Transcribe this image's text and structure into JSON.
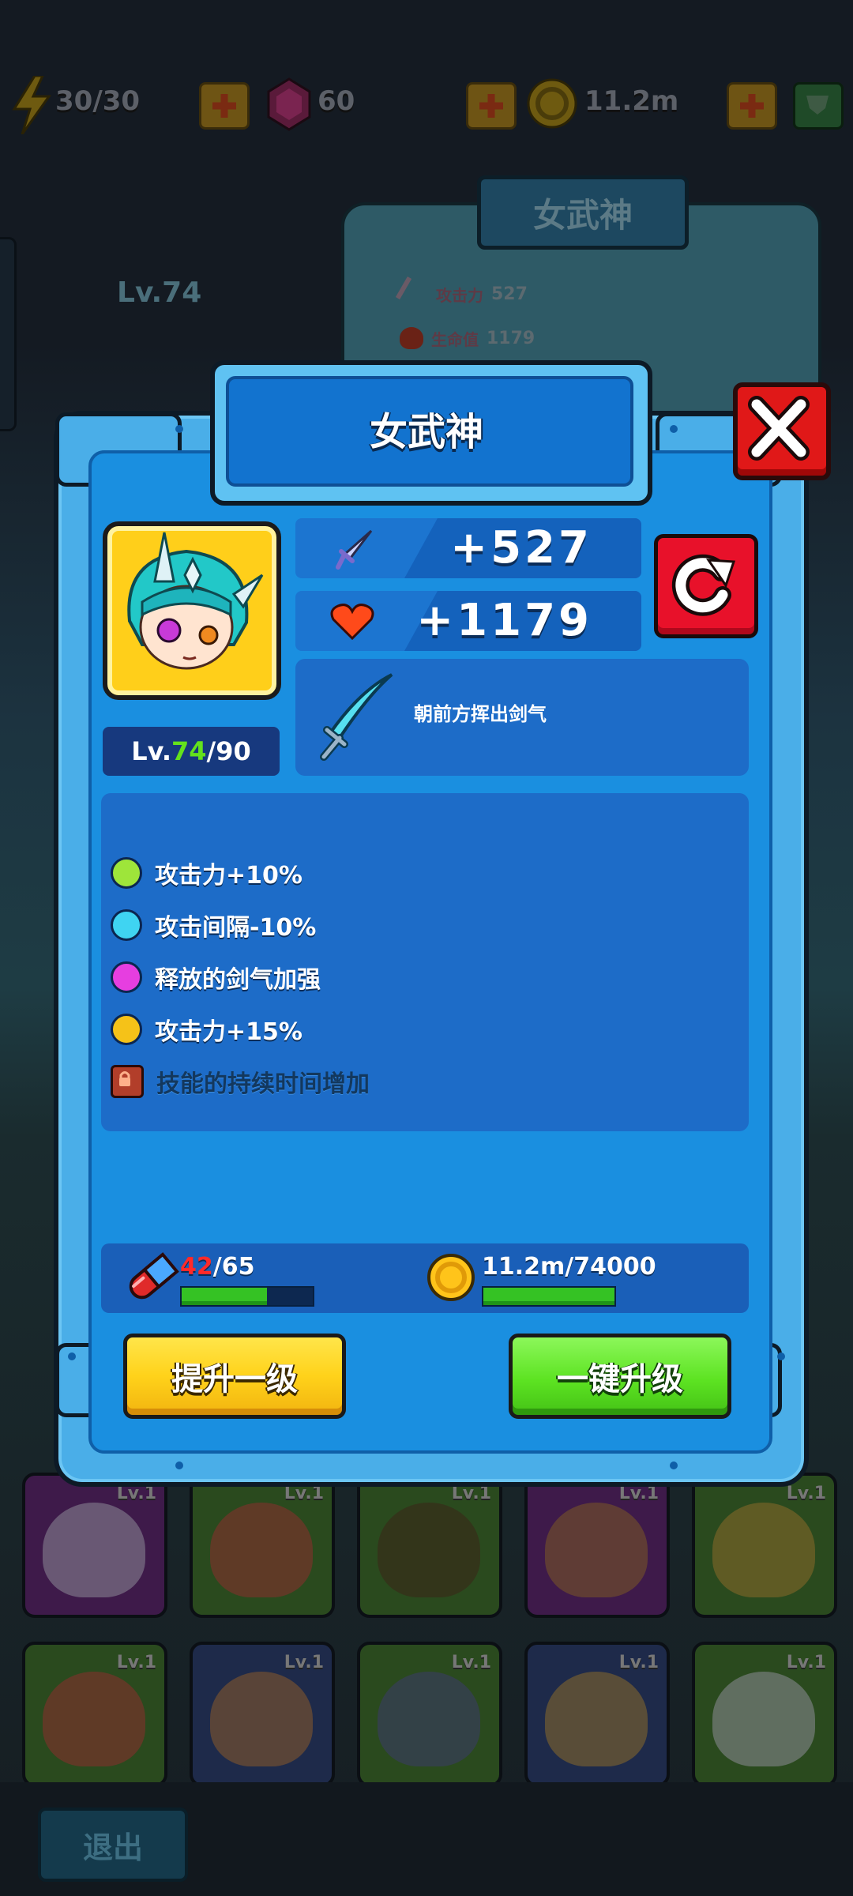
{
  "top_bar": {
    "energy": "30/30",
    "gems": "60",
    "gold": "11.2m"
  },
  "background": {
    "hero_name": "女武神",
    "hero_level": "Lv.74",
    "attack_label": "攻击力",
    "attack_value": "527",
    "hp_label": "生命值",
    "hp_value": "1179",
    "card_level": "Lv.1",
    "exit_label": "退出"
  },
  "dialog": {
    "title": "女武神",
    "level_current": "74",
    "level_prefix": "Lv.",
    "level_max": "/90",
    "attack_bonus": "+527",
    "hp_bonus": "+1179",
    "skill_description": "朝前方挥出剑气",
    "traits": [
      {
        "label": "攻击力+10%",
        "color": "#9ee53a",
        "locked": false
      },
      {
        "label": "攻击间隔-10%",
        "color": "#3fd4f2",
        "locked": false
      },
      {
        "label": "释放的剑气加强",
        "color": "#e63ee0",
        "locked": false
      },
      {
        "label": "攻击力+15%",
        "color": "#f5c218",
        "locked": false
      },
      {
        "label": "技能的持续时间增加",
        "color": "#b23e2a",
        "locked": true
      }
    ],
    "potion_have": "42",
    "potion_need": "/65",
    "potion_progress": 0.65,
    "gold_text": "11.2m/74000",
    "gold_progress": 1.0,
    "upgrade_one_label": "提升一级",
    "upgrade_all_label": "一键升级"
  },
  "colors": {
    "dialog_blue": "#1a8fe0",
    "level_green": "#63e21c",
    "potion_red": "#ff2a2a"
  }
}
